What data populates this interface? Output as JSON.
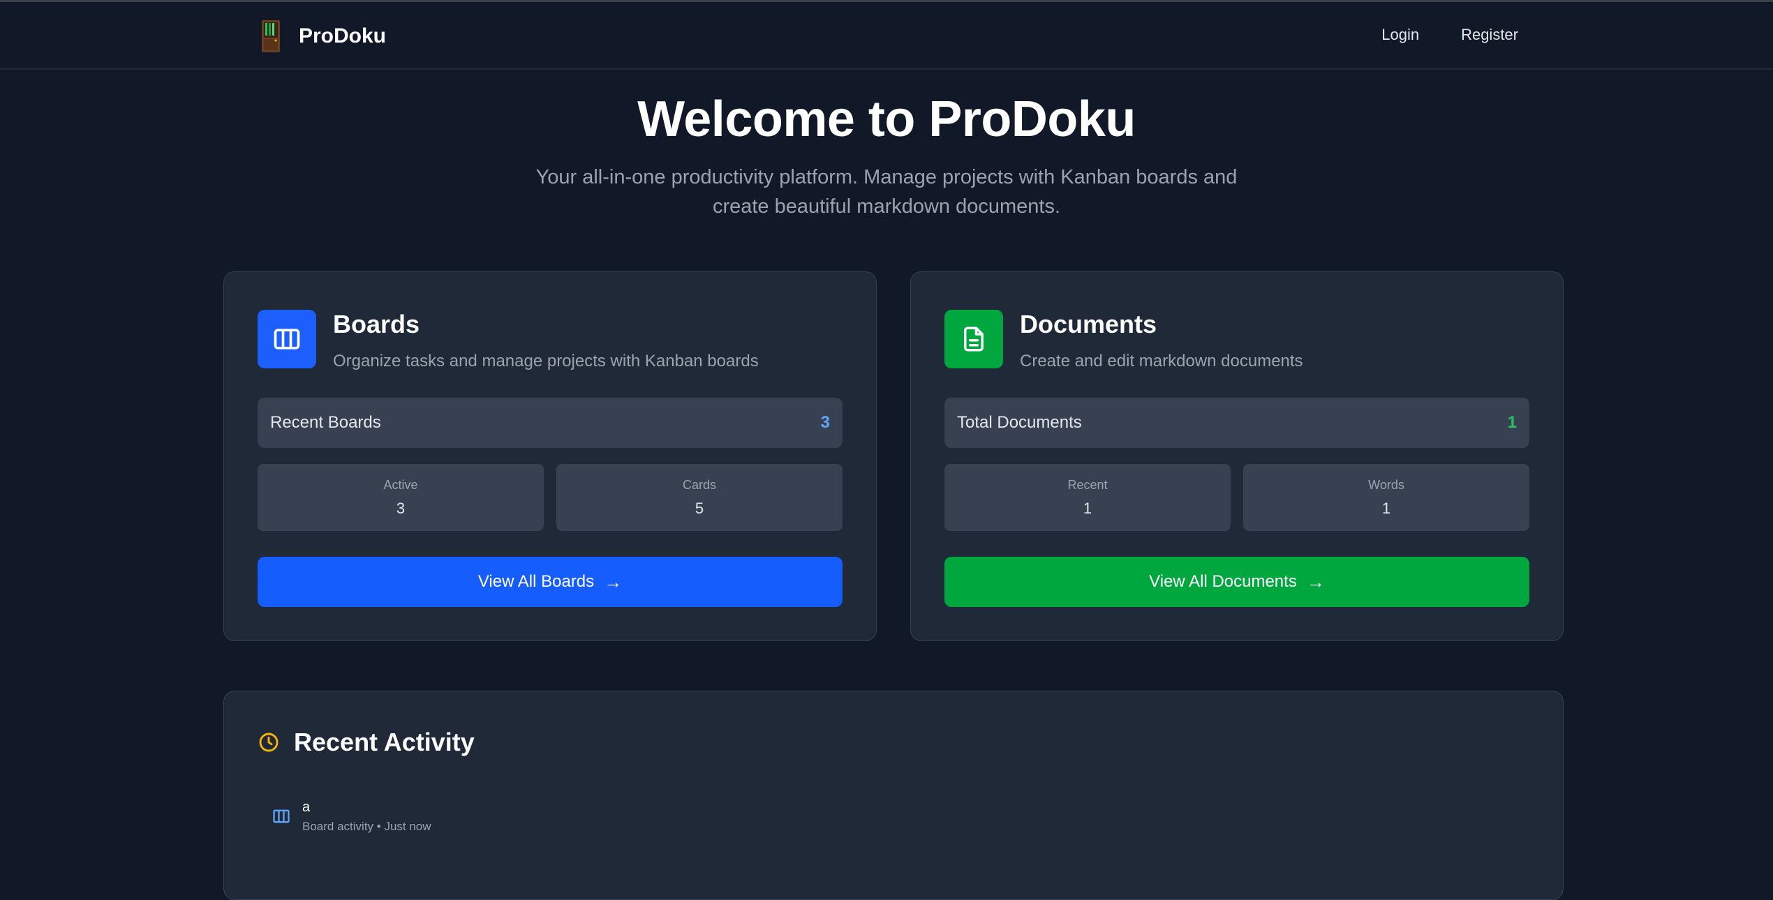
{
  "nav": {
    "brand": "ProDoku",
    "login": "Login",
    "register": "Register"
  },
  "hero": {
    "title": "Welcome to ProDoku",
    "subtitle": "Your all-in-one productivity platform. Manage projects with Kanban boards and create beautiful markdown documents."
  },
  "boards": {
    "title": "Boards",
    "description": "Organize tasks and manage projects with Kanban boards",
    "recent_label": "Recent Boards",
    "recent_value": "3",
    "stats": [
      {
        "label": "Active",
        "value": "3"
      },
      {
        "label": "Cards",
        "value": "5"
      }
    ],
    "button": "View All Boards",
    "accent": "#155dfc",
    "icon": "kanban-icon"
  },
  "documents": {
    "title": "Documents",
    "description": "Create and edit markdown documents",
    "total_label": "Total Documents",
    "total_value": "1",
    "stats": [
      {
        "label": "Recent",
        "value": "1"
      },
      {
        "label": "Words",
        "value": "1"
      }
    ],
    "button": "View All Documents",
    "accent": "#00a63e",
    "icon": "document-icon"
  },
  "activity": {
    "title": "Recent Activity",
    "items": [
      {
        "name": "a",
        "meta": "Board activity • Just now",
        "icon": "kanban-icon"
      }
    ]
  },
  "arrow": "→"
}
